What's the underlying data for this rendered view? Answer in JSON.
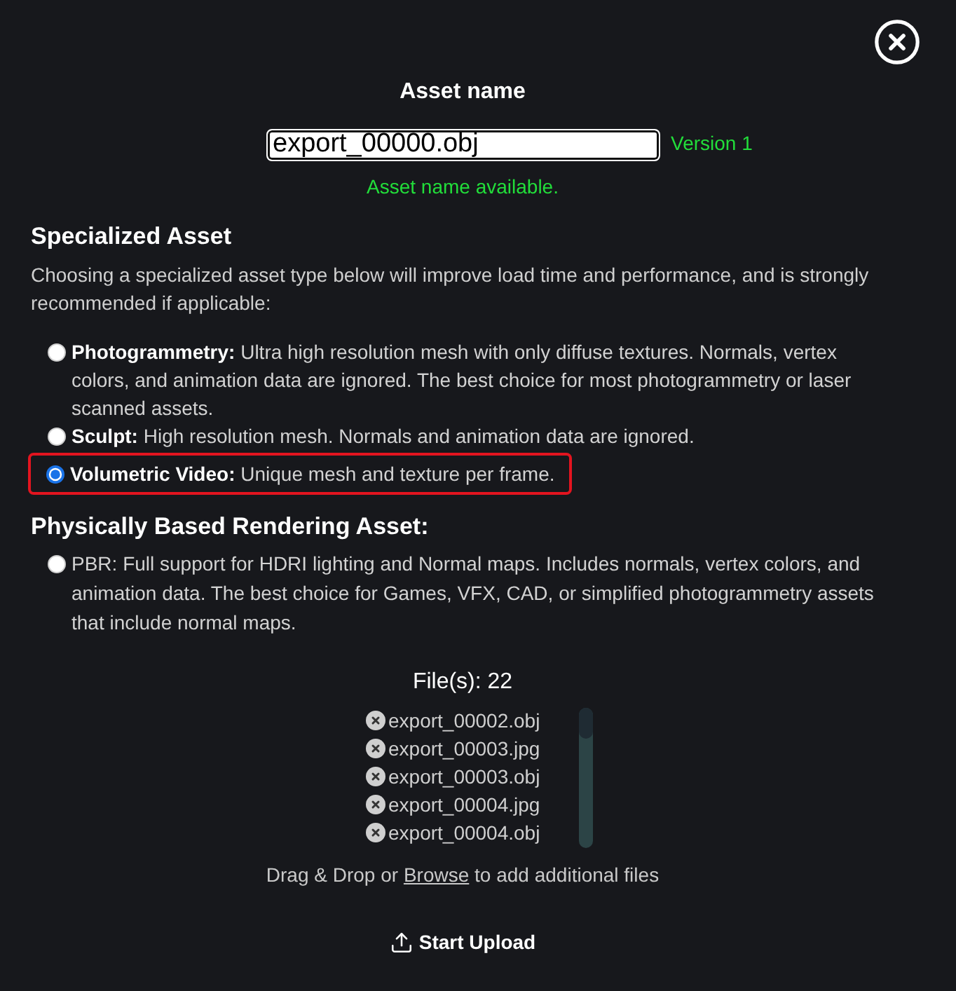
{
  "asset_name": {
    "label": "Asset name",
    "value": "export_00000.obj",
    "version": "Version 1",
    "status": "Asset name available."
  },
  "specialized": {
    "title": "Specialized Asset",
    "description": "Choosing a specialized asset type below will improve load time and performance, and is strongly recommended if applicable:",
    "options": [
      {
        "text": "**Photogrammetry:** Ultra high resolution mesh with only diffuse textures. Normals, vertex colors, and animation data are ignored. The best choice for most photogrammetry or laser scanned assets.",
        "selected": false,
        "highlighted": false
      },
      {
        "text": "**Sculpt:** High resolution mesh. Normals and animation data are ignored.",
        "selected": false,
        "highlighted": false
      },
      {
        "text": "**Volumetric Video:** Unique mesh and texture per frame.",
        "selected": true,
        "highlighted": true
      }
    ]
  },
  "pbr": {
    "title": "Physically Based Rendering Asset:",
    "options": [
      {
        "text": "PBR: Full support for HDRI lighting and Normal maps. Includes normals, vertex colors, and animation data. The best choice for Games, VFX, CAD, or simplified photogrammetry assets that include normal maps.",
        "selected": false,
        "highlighted": false
      }
    ]
  },
  "files": {
    "count": "File(s): 22",
    "items": [
      "export_00002.obj",
      "export_00003.jpg",
      "export_00003.obj",
      "export_00004.jpg",
      "export_00004.obj"
    ]
  },
  "drop_hint": {
    "before": "Drag & Drop or",
    "link": "Browse",
    "after": "to add additional files"
  },
  "upload_button": {
    "label": "Start Upload"
  }
}
